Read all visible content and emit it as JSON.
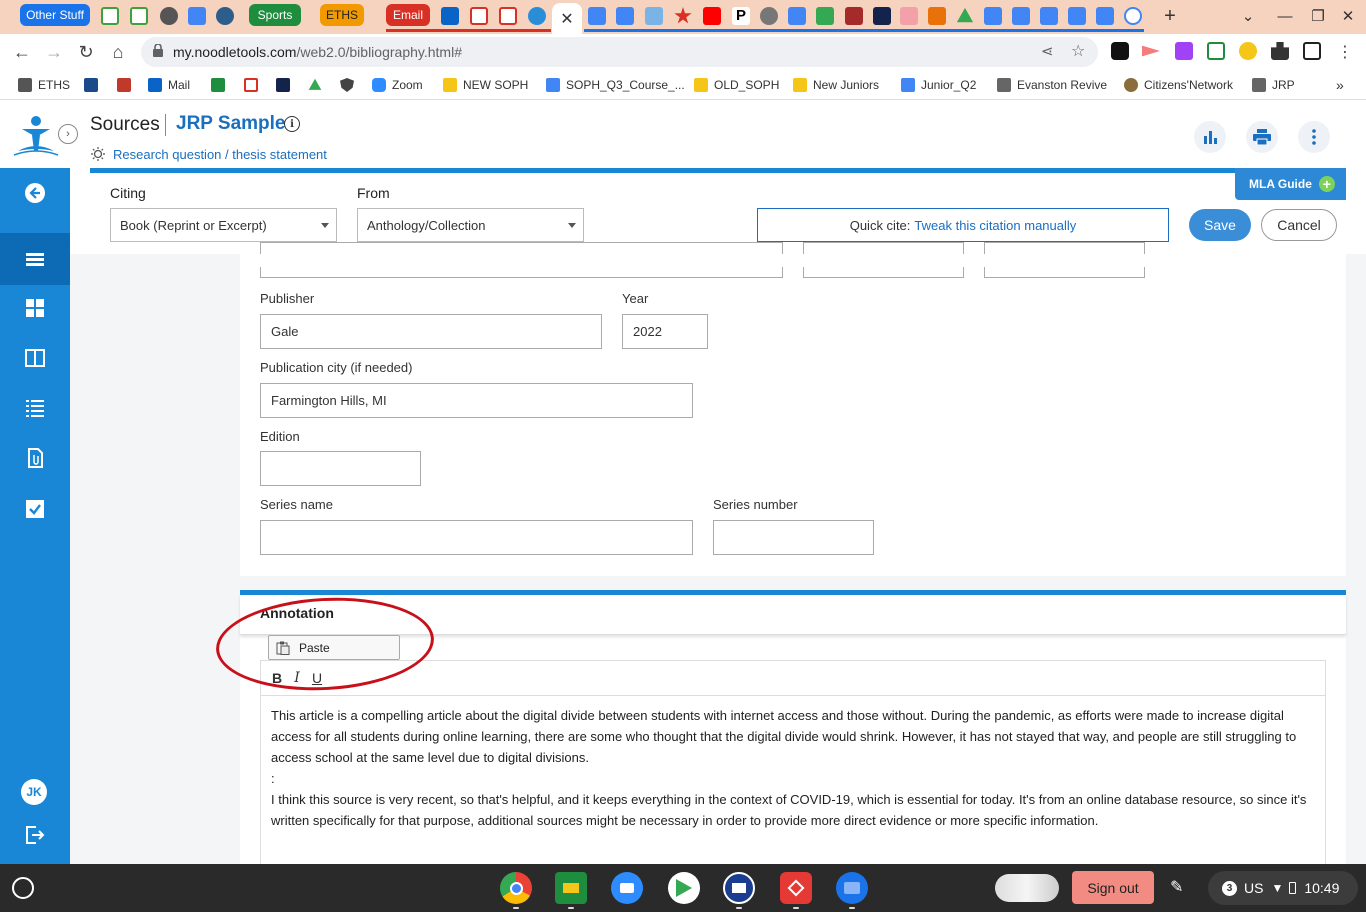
{
  "browser": {
    "tab_groups": [
      {
        "label": "Other Stuff",
        "color": "#1a73e8"
      },
      {
        "label": "Sports",
        "color": "#1e8e3e"
      },
      {
        "label": "ETHS",
        "color": "#f29900"
      },
      {
        "label": "Email",
        "color": "#d93025"
      }
    ],
    "url_host": "my.noodletools.com",
    "url_path": "/web2.0/bibliography.html#",
    "bookmarks": [
      "ETHS",
      "Mail",
      "Zoom",
      "NEW SOPH",
      "SOPH_Q3_Course_...",
      "OLD_SOPH",
      "New Juniors",
      "Junior_Q2",
      "Evanston Revive",
      "Citizens'Network",
      "JRP"
    ]
  },
  "app": {
    "section": "Sources",
    "project": "JRP Sample",
    "research_link": "Research question / thesis statement",
    "user_initials": "JK",
    "brand_color": "#1a87d6"
  },
  "citing": {
    "citing_label": "Citing",
    "citing_value": "Book (Reprint or Excerpt)",
    "from_label": "From",
    "from_value": "Anthology/Collection",
    "quick_cite_prefix": "Quick cite:",
    "quick_cite_link": "Tweak this citation manually",
    "save": "Save",
    "cancel": "Cancel",
    "mla_guide": "MLA Guide"
  },
  "form": {
    "publisher_label": "Publisher",
    "publisher_value": "Gale",
    "year_label": "Year",
    "year_value": "2022",
    "city_label": "Publication city (if needed)",
    "city_value": "Farmington Hills, MI",
    "edition_label": "Edition",
    "edition_value": "",
    "series_name_label": "Series name",
    "series_name_value": "",
    "series_number_label": "Series number",
    "series_number_value": ""
  },
  "annotation": {
    "title": "Annotation",
    "paste_label": "Paste",
    "bold": "B",
    "italic": "I",
    "underline": "U",
    "para1": "This article is a compelling article about the digital divide between students with internet access and those without.  During the pandemic, as efforts were made to increase digital access for all students during online learning, there are some who thought that the digital divide would shrink. However, it has not stayed that way, and people are still struggling to access school at the same level due to digital divisions.",
    "para2": ":",
    "para3": "I think this source is very recent, so that's helpful, and it keeps everything in the context of COVID-19, which is essential for today. It's from an online database resource, so since it's written specifically for that purpose, additional sources might be necessary in order to provide more direct evidence or more specific information."
  },
  "shelf": {
    "sign_out": "Sign out",
    "notification_count": "3",
    "input_method": "US",
    "time": "10:49"
  }
}
